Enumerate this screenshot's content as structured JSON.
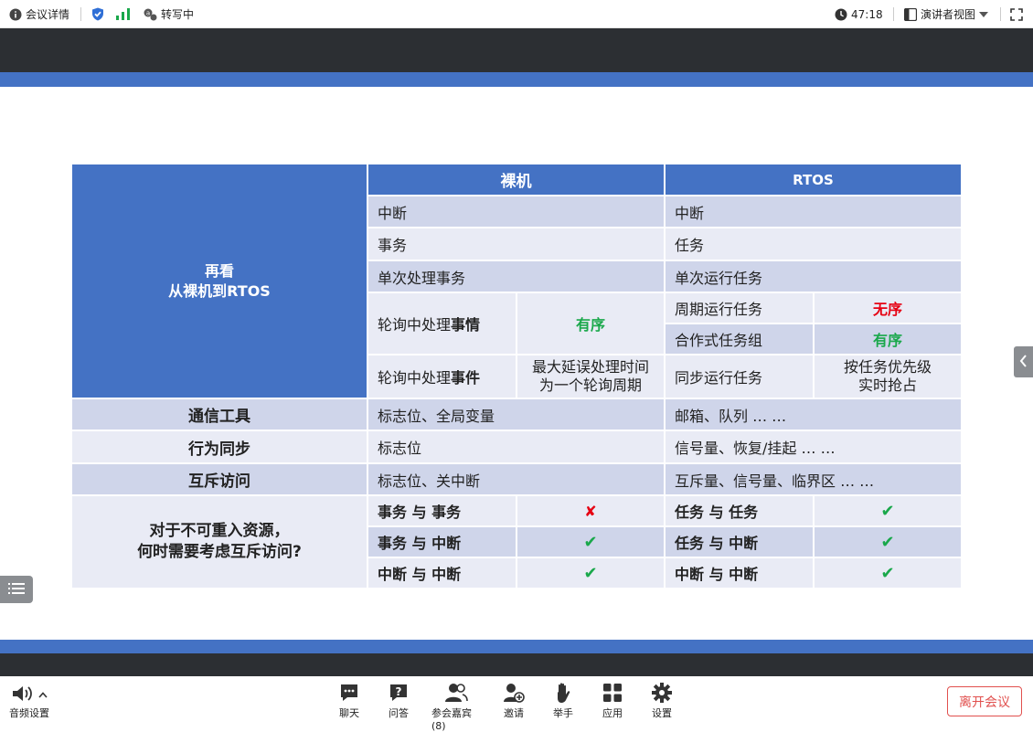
{
  "topbar": {
    "meeting_info": "会议详情",
    "transcribing": "转写中",
    "time": "47:18",
    "view_mode": "演讲者视图"
  },
  "slide": {
    "title_line1": "再看",
    "title_line2": "从裸机到RTOS",
    "col_bare": "裸机",
    "col_rtos": "RTOS",
    "rows": {
      "r1_bare": "中断",
      "r1_rtos": "中断",
      "r2_bare": "事务",
      "r2_rtos": "任务",
      "r3_bare": "单次处理事务",
      "r3_rtos": "单次运行任务",
      "r4_bare_pre": "轮询中处理",
      "r4_bare_em": "事情",
      "r4_bare_val": "有序",
      "r4a_rtos": "周期运行任务",
      "r4a_rtos_val": "无序",
      "r4b_rtos": "合作式任务组",
      "r4b_rtos_val": "有序",
      "r5_bare_pre": "轮询中处理",
      "r5_bare_em": "事件",
      "r5_bare_val_l1": "最大延误处理时间",
      "r5_bare_val_l2": "为一个轮询周期",
      "r5_rtos": "同步运行任务",
      "r5_rtos_val_l1": "按任务优先级",
      "r5_rtos_val_l2": "实时抢占"
    },
    "comm": {
      "label": "通信工具",
      "bare": "标志位、全局变量",
      "rtos": "邮箱、队列 … …"
    },
    "sync": {
      "label": "行为同步",
      "bare": "标志位",
      "rtos": "信号量、恢复/挂起 … …"
    },
    "mutex": {
      "label": "互斥访问",
      "bare": "标志位、关中断",
      "rtos": "互斥量、信号量、临界区 … …"
    },
    "reentrant": {
      "question_l1": "对于不可重入资源，",
      "question_l2": "何时需要考虑互斥访问?",
      "b1": "事务 与 事务",
      "b1_mark": "✘",
      "b2": "事务 与 中断",
      "b2_mark": "✔",
      "b3": "中断 与 中断",
      "b3_mark": "✔",
      "t1": "任务 与 任务",
      "t1_mark": "✔",
      "t2": "任务 与 中断",
      "t2_mark": "✔",
      "t3": "中断 与 中断",
      "t3_mark": "✔"
    }
  },
  "bottombar": {
    "audio": "音频设置",
    "chat": "聊天",
    "qa": "问答",
    "participants": "参会嘉宾(8)",
    "invite": "邀请",
    "raise_hand": "举手",
    "apps": "应用",
    "settings": "设置",
    "leave": "离开会议"
  },
  "colors": {
    "accent_blue": "#4472c4",
    "row_dark": "#cfd5ea",
    "row_light": "#e9ebf5",
    "ok_green": "#1aa84b",
    "bad_red": "#e60012",
    "leave_red": "#e1504e"
  }
}
